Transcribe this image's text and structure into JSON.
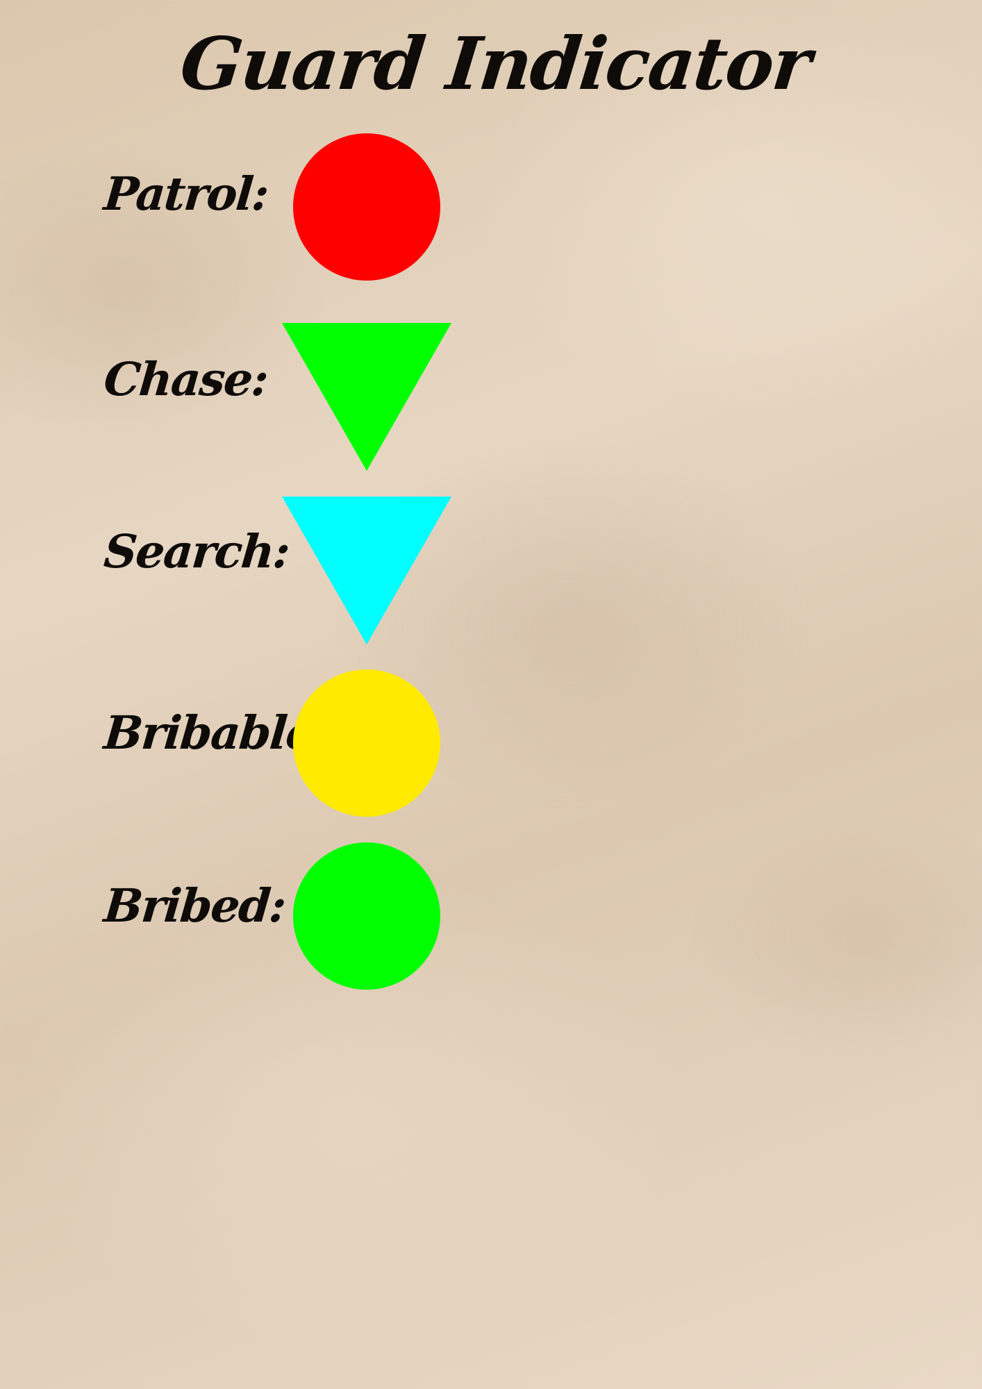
{
  "title": "Guard Indicator",
  "indicators": [
    {
      "label": "Patrol:",
      "shape": "circle",
      "color": "#ff0000"
    },
    {
      "label": "Chase:",
      "shape": "triangle-down",
      "color": "#00ff00"
    },
    {
      "label": "Search:",
      "shape": "triangle-down",
      "color": "#00ffff"
    },
    {
      "label": "Bribable:",
      "shape": "circle",
      "color": "#ffea00"
    },
    {
      "label": "Bribed:",
      "shape": "circle",
      "color": "#00ff00"
    }
  ]
}
